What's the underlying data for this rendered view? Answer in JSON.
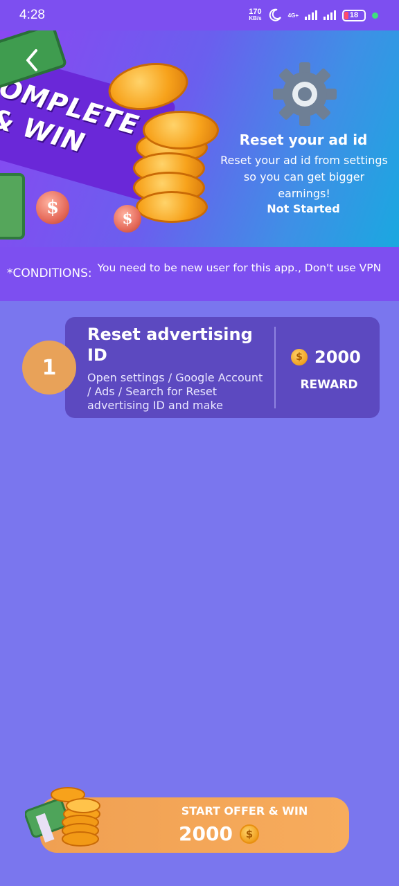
{
  "status_bar": {
    "time": "4:28",
    "speed_value": "170",
    "speed_unit": "KB/s",
    "network": "4G+",
    "battery": "18"
  },
  "banner": {
    "ribbon_line1": "OMPLETE",
    "ribbon_line2": "& WIN",
    "title": "Reset your ad id",
    "description": "Reset your ad id from settings so you can get bigger earnings!",
    "status": "Not Started"
  },
  "conditions": {
    "label": "*CONDITIONS:",
    "text": "You need to be new user for this app., Don't use VPN"
  },
  "task": {
    "step": "1",
    "title": "Reset advertising ID",
    "description": "Open settings / Google Account / Ads / Search for Reset advertising ID and make",
    "reward_amount": "2000",
    "reward_label": "REWARD"
  },
  "start_button": {
    "label": "START OFFER & WIN",
    "amount": "2000"
  },
  "colors": {
    "background": "#7a76ee",
    "header_purple": "#7d4ff0",
    "card": "#5c49c0",
    "accent_orange": "#f0a052",
    "coin_gold": "#f0a020"
  }
}
